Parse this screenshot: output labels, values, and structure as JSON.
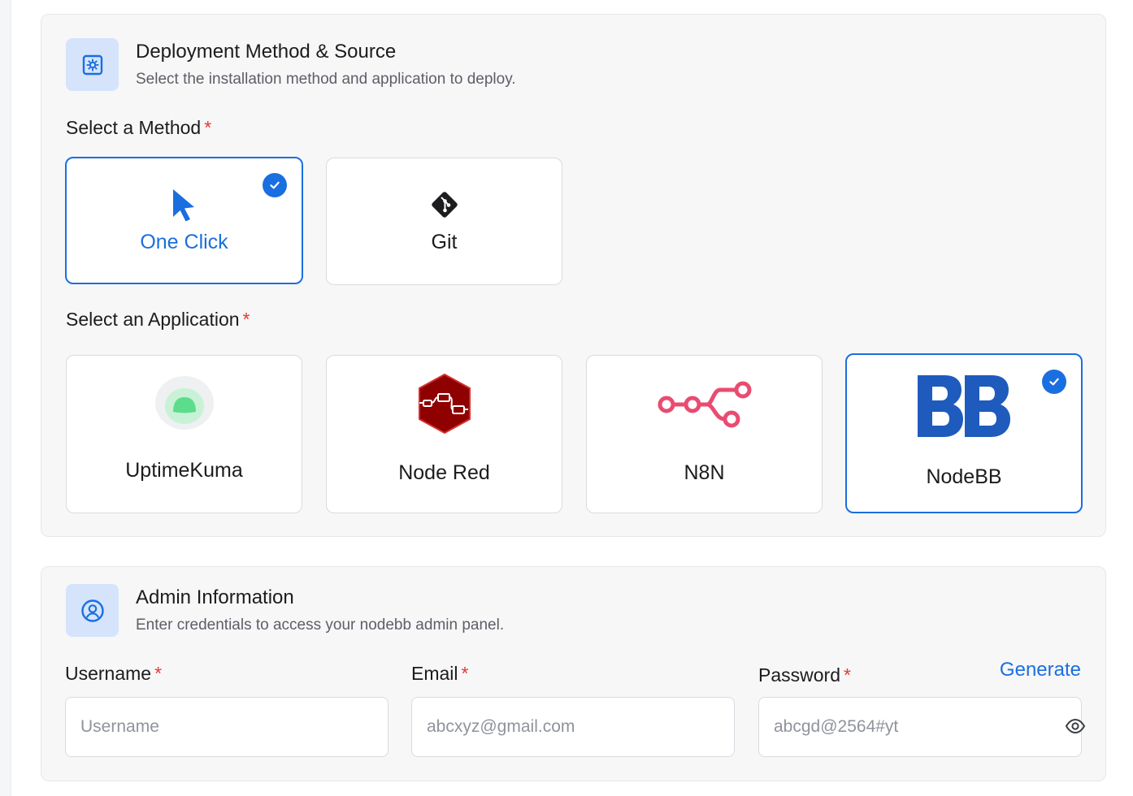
{
  "deployment": {
    "title": "Deployment Method & Source",
    "subtitle": "Select the installation method and application to deploy.",
    "method_label": "Select a Method",
    "required_mark": "*",
    "methods": [
      {
        "label": "One Click",
        "icon": "cursor-icon",
        "selected": true
      },
      {
        "label": "Git",
        "icon": "git-icon",
        "selected": false
      }
    ],
    "application_label": "Select an Application",
    "applications": [
      {
        "label": "UptimeKuma",
        "icon": "uptimekuma-logo",
        "selected": false
      },
      {
        "label": "Node Red",
        "icon": "node-red-logo",
        "selected": false
      },
      {
        "label": "N8N",
        "icon": "n8n-logo",
        "selected": false
      },
      {
        "label": "NodeBB",
        "icon": "nodebb-logo",
        "selected": true
      }
    ]
  },
  "admin": {
    "title": "Admin Information",
    "subtitle": "Enter credentials to access your nodebb admin panel.",
    "username": {
      "label": "Username",
      "placeholder": "Username",
      "value": ""
    },
    "email": {
      "label": "Email",
      "placeholder": "abcxyz@gmail.com",
      "value": ""
    },
    "password": {
      "label": "Password",
      "placeholder": "abcgd@2564#yt",
      "value": ""
    },
    "generate_label": "Generate"
  },
  "colors": {
    "accent": "#1a6fe0",
    "required": "#e53935",
    "section_bg": "#f7f7f8",
    "icon_tile": "#d5e4fb",
    "node_red": "#8f0000",
    "n8n": "#ea4b71",
    "uptimekuma": "#5cdd8b",
    "nodebb": "#1e5bbd"
  }
}
